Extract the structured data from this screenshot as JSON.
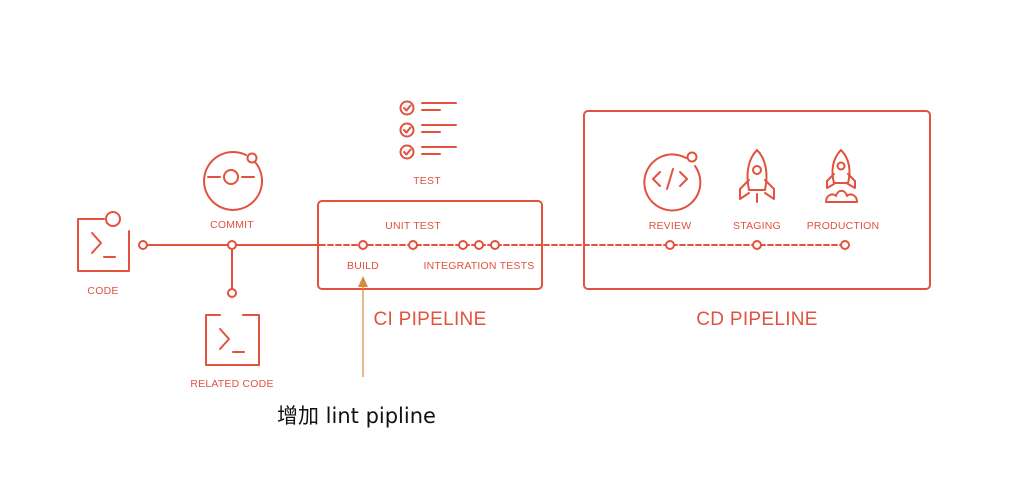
{
  "labels": {
    "code": "CODE",
    "commit": "COMMIT",
    "related_code": "RELATED CODE",
    "test": "TEST",
    "unit_test": "UNIT TEST",
    "build": "BUILD",
    "integration_tests": "INTEGRATION TESTS",
    "ci_pipeline": "CI PIPELINE",
    "review": "REVIEW",
    "staging": "STAGING",
    "production": "PRODUCTION",
    "cd_pipeline": "CD PIPELINE"
  },
  "annotation": {
    "text": "增加 lint pipline"
  },
  "colors": {
    "diagram": "#e2523f",
    "annotation_arrow": "#d98a3a",
    "annotation_text": "#111111"
  },
  "icons": [
    "terminal-icon",
    "commit-icon",
    "checklist-icon",
    "code-review-icon",
    "rocket-icon",
    "rocket-launch-icon"
  ]
}
